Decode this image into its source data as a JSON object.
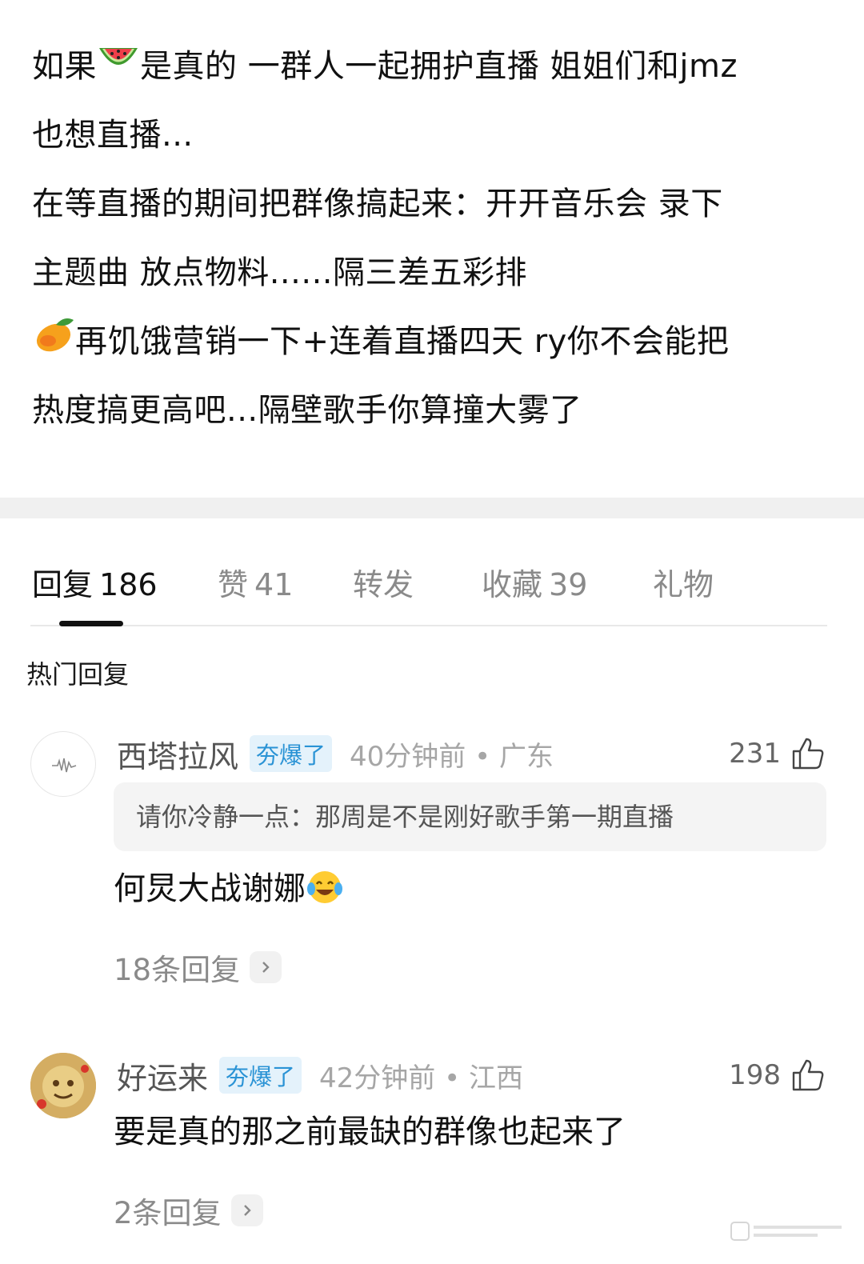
{
  "post": {
    "lines": [
      {
        "before": "如果",
        "emoji": "watermelon-emoji",
        "after": "是真的 一群人一起拥护直播 姐姐们和jmz"
      },
      {
        "text": "也想直播..."
      },
      {
        "text": "在等直播的期间把群像搞起来：开开音乐会 录下"
      },
      {
        "text": "主题曲 放点物料......隔三差五彩排"
      },
      {
        "emoji": "mango-emoji",
        "after": "再饥饿营销一下+连着直播四天 ry你不会能把"
      },
      {
        "text": "热度搞更高吧...隔壁歌手你算撞大雾了"
      }
    ]
  },
  "tabs": [
    {
      "label": "回复",
      "count": "186",
      "active": true
    },
    {
      "label": "赞",
      "count": "41"
    },
    {
      "label": "转发",
      "count": ""
    },
    {
      "label": "收藏",
      "count": "39"
    },
    {
      "label": "礼物",
      "count": ""
    }
  ],
  "hot_title": "热门回复",
  "comments": [
    {
      "username": "西塔拉风",
      "badge": "夯爆了",
      "time_location": "40分钟前 • 广东",
      "likes": "231",
      "quote": "请你冷静一点：那周是不是刚好歌手第一期直播",
      "text": "何炅大战谢娜",
      "emoji": "laughing-tears-emoji",
      "replies": "18条回复"
    },
    {
      "username": "好运来",
      "badge": "夯爆了",
      "time_location": "42分钟前 • 江西",
      "likes": "198",
      "text": "要是真的那之前最缺的群像也起来了",
      "replies": "2条回复"
    }
  ],
  "colors": {
    "badge_bg": "#e4f2fb",
    "badge_text": "#2a93d5",
    "separator": "#f0f0f0"
  }
}
